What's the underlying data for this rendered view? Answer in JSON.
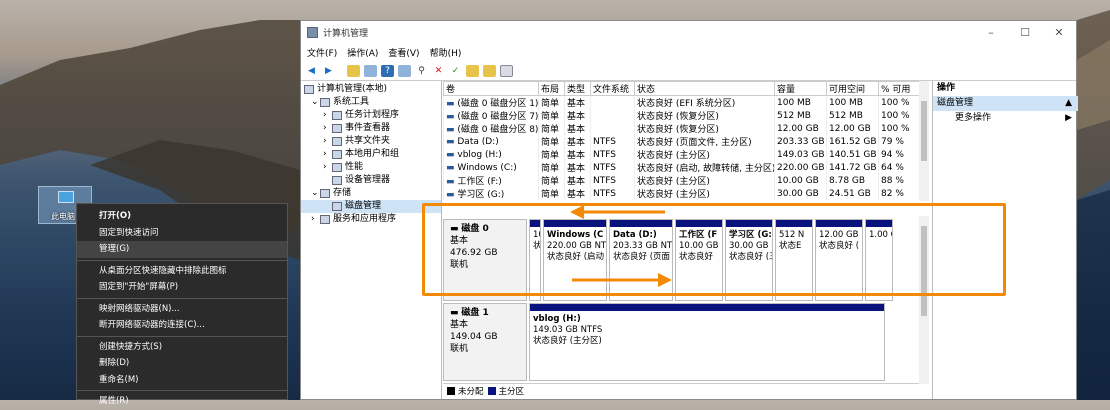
{
  "desktop": {
    "icon_label": "此电脑"
  },
  "context_menu": {
    "items": [
      "打开(O)",
      "固定到快速访问",
      "管理(G)",
      "从桌面分区快速隐藏中排除此图标",
      "固定到\"开始\"屏幕(P)",
      "映射网络驱动器(N)...",
      "断开网络驱动器的连接(C)...",
      "创建快捷方式(S)",
      "删除(D)",
      "重命名(M)",
      "属性(R)"
    ]
  },
  "window": {
    "title": "计算机管理",
    "menu": [
      "文件(F)",
      "操作(A)",
      "查看(V)",
      "帮助(H)"
    ],
    "tree": [
      "计算机管理(本地)",
      "系统工具",
      "任务计划程序",
      "事件查看器",
      "共享文件夹",
      "本地用户和组",
      "性能",
      "设备管理器",
      "存储",
      "磁盘管理",
      "服务和应用程序"
    ],
    "columns": [
      "卷",
      "布局",
      "类型",
      "文件系统",
      "状态",
      "容量",
      "可用空间",
      "% 可用"
    ],
    "volumes": [
      [
        "(磁盘 0 磁盘分区 1)",
        "简单",
        "基本",
        "",
        "状态良好 (EFI 系统分区)",
        "100 MB",
        "100 MB",
        "100 %"
      ],
      [
        "(磁盘 0 磁盘分区 7)",
        "简单",
        "基本",
        "",
        "状态良好 (恢复分区)",
        "512 MB",
        "512 MB",
        "100 %"
      ],
      [
        "(磁盘 0 磁盘分区 8)",
        "简单",
        "基本",
        "",
        "状态良好 (恢复分区)",
        "12.00 GB",
        "12.00 GB",
        "100 %"
      ],
      [
        "Data (D:)",
        "简单",
        "基本",
        "NTFS",
        "状态良好 (页面文件, 主分区)",
        "203.33 GB",
        "161.52 GB",
        "79 %"
      ],
      [
        "vblog (H:)",
        "简单",
        "基本",
        "NTFS",
        "状态良好 (主分区)",
        "149.03 GB",
        "140.51 GB",
        "94 %"
      ],
      [
        "Windows (C:)",
        "简单",
        "基本",
        "NTFS",
        "状态良好 (启动, 故障转储, 主分区)",
        "220.00 GB",
        "141.72 GB",
        "64 %"
      ],
      [
        "工作区 (F:)",
        "简单",
        "基本",
        "NTFS",
        "状态良好 (主分区)",
        "10.00 GB",
        "8.78 GB",
        "88 %"
      ],
      [
        "学习区 (G:)",
        "简单",
        "基本",
        "NTFS",
        "状态良好 (主分区)",
        "30.00 GB",
        "24.51 GB",
        "82 %"
      ]
    ],
    "disk0": {
      "name": "磁盘 0",
      "type": "基本",
      "size": "476.92 GB",
      "status": "联机",
      "partitions": [
        {
          "l1": "",
          "l2": "10(",
          "l3": "状态"
        },
        {
          "l1": "Windows (C",
          "l2": "220.00 GB NT",
          "l3": "状态良好 (启动"
        },
        {
          "l1": "Data (D:)",
          "l2": "203.33 GB NT",
          "l3": "状态良好 (页面"
        },
        {
          "l1": "工作区 (F",
          "l2": "10.00 GB",
          "l3": "状态良好"
        },
        {
          "l1": "学习区 (G:",
          "l2": "30.00 GB N",
          "l3": "状态良好 (三"
        },
        {
          "l1": "",
          "l2": "512 N",
          "l3": "状态E"
        },
        {
          "l1": "",
          "l2": "12.00 GB",
          "l3": "状态良好 ("
        },
        {
          "l1": "",
          "l2": "1.00 G",
          "l3": ""
        }
      ]
    },
    "disk1": {
      "name": "磁盘 1",
      "type": "基本",
      "size": "149.04 GB",
      "status": "联机",
      "partition": {
        "l1": "vblog (H:)",
        "l2": "149.03 GB NTFS",
        "l3": "状态良好 (主分区)"
      }
    },
    "legend": [
      "未分配",
      "主分区"
    ],
    "actions": {
      "header": "操作",
      "selected": "磁盘管理",
      "more": "更多操作"
    }
  },
  "colors": {
    "highlight": "#f28a08",
    "partition_bar": "#0a127e",
    "selection": "#cfe3f6"
  }
}
